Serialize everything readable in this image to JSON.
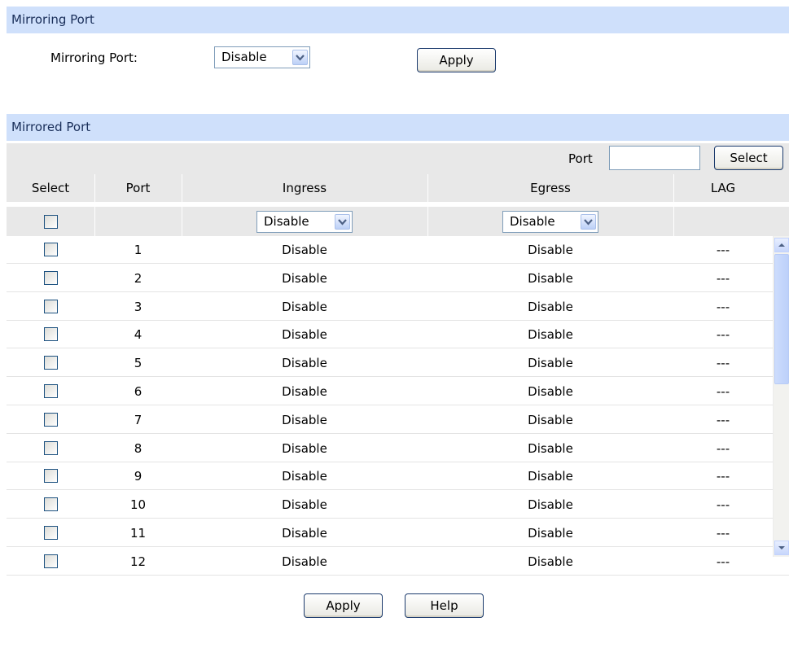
{
  "mirroring": {
    "header": "Mirroring Port",
    "label": "Mirroring Port:",
    "select_value": "Disable",
    "apply_label": "Apply"
  },
  "mirrored": {
    "header": "Mirrored Port",
    "port_filter_label": "Port",
    "port_filter_value": "",
    "select_button": "Select",
    "columns": [
      "Select",
      "Port",
      "Ingress",
      "Egress",
      "LAG"
    ],
    "ingress_all": "Disable",
    "egress_all": "Disable",
    "rows": [
      {
        "port": "1",
        "ingress": "Disable",
        "egress": "Disable",
        "lag": "---"
      },
      {
        "port": "2",
        "ingress": "Disable",
        "egress": "Disable",
        "lag": "---"
      },
      {
        "port": "3",
        "ingress": "Disable",
        "egress": "Disable",
        "lag": "---"
      },
      {
        "port": "4",
        "ingress": "Disable",
        "egress": "Disable",
        "lag": "---"
      },
      {
        "port": "5",
        "ingress": "Disable",
        "egress": "Disable",
        "lag": "---"
      },
      {
        "port": "6",
        "ingress": "Disable",
        "egress": "Disable",
        "lag": "---"
      },
      {
        "port": "7",
        "ingress": "Disable",
        "egress": "Disable",
        "lag": "---"
      },
      {
        "port": "8",
        "ingress": "Disable",
        "egress": "Disable",
        "lag": "---"
      },
      {
        "port": "9",
        "ingress": "Disable",
        "egress": "Disable",
        "lag": "---"
      },
      {
        "port": "10",
        "ingress": "Disable",
        "egress": "Disable",
        "lag": "---"
      },
      {
        "port": "11",
        "ingress": "Disable",
        "egress": "Disable",
        "lag": "---"
      },
      {
        "port": "12",
        "ingress": "Disable",
        "egress": "Disable",
        "lag": "---"
      }
    ]
  },
  "footer": {
    "apply_label": "Apply",
    "help_label": "Help"
  },
  "colors": {
    "header_bg": "#cfe0fb",
    "header_text": "#1a2f5a",
    "gray_bar": "#e8e8e8"
  }
}
